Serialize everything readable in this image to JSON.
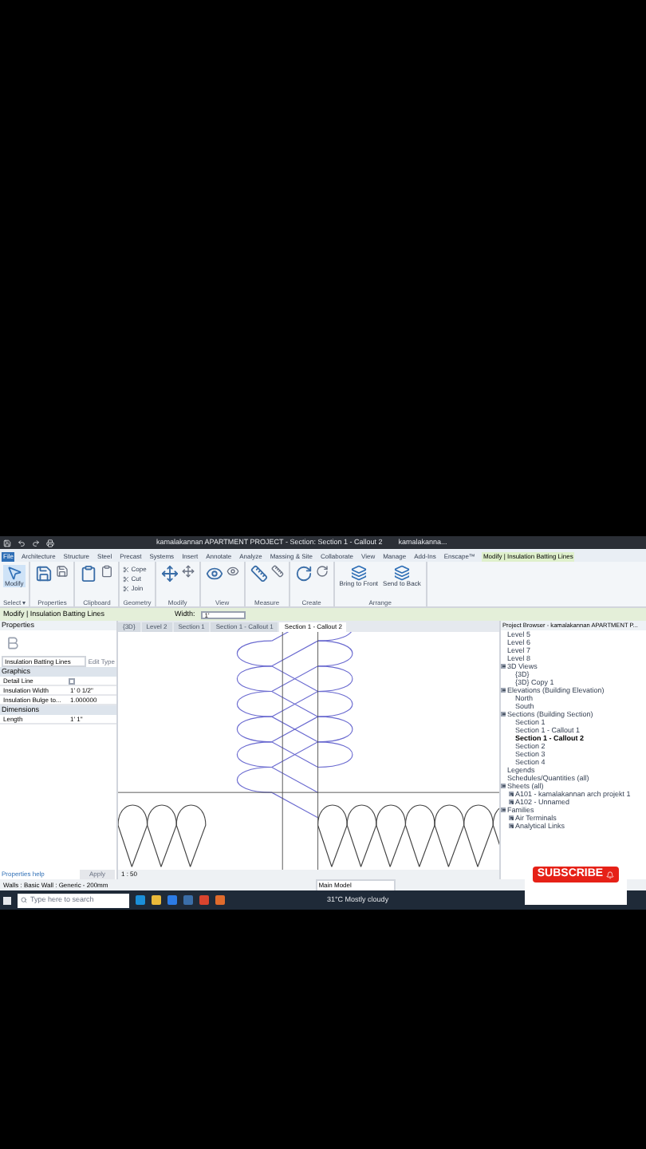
{
  "window": {
    "title": "kamalakannan APARTMENT PROJECT - Section: Section 1 - Callout 2",
    "user": "kamalakanna..."
  },
  "ribbon_tabs": [
    {
      "label": "File",
      "selected": false
    },
    {
      "label": "Architecture",
      "selected": false
    },
    {
      "label": "Structure",
      "selected": false
    },
    {
      "label": "Steel",
      "selected": false
    },
    {
      "label": "Precast",
      "selected": false
    },
    {
      "label": "Systems",
      "selected": false
    },
    {
      "label": "Insert",
      "selected": false
    },
    {
      "label": "Annotate",
      "selected": false
    },
    {
      "label": "Analyze",
      "selected": false
    },
    {
      "label": "Massing & Site",
      "selected": false
    },
    {
      "label": "Collaborate",
      "selected": false
    },
    {
      "label": "View",
      "selected": false
    },
    {
      "label": "Manage",
      "selected": false
    },
    {
      "label": "Add-Ins",
      "selected": false
    },
    {
      "label": "Enscape™",
      "selected": false
    },
    {
      "label": "Modify | Insulation Batting Lines",
      "selected": true
    }
  ],
  "ribbon_panels": [
    {
      "label": "Select ▾",
      "tools": [
        {
          "label": "Modify",
          "kind": "pointer"
        }
      ]
    },
    {
      "label": "Properties",
      "tools": [
        {
          "kind": "props"
        }
      ]
    },
    {
      "label": "Clipboard",
      "tools": [
        {
          "kind": "paste"
        }
      ]
    },
    {
      "label": "Geometry",
      "tools": [
        {
          "label": "Cope",
          "kind": "small"
        },
        {
          "label": "Cut",
          "kind": "small"
        },
        {
          "label": "Join",
          "kind": "small"
        }
      ]
    },
    {
      "label": "Modify",
      "tools": [
        {
          "kind": "modify"
        }
      ]
    },
    {
      "label": "View",
      "tools": [
        {
          "kind": "view"
        }
      ]
    },
    {
      "label": "Measure",
      "tools": [
        {
          "kind": "measure"
        }
      ]
    },
    {
      "label": "Create",
      "tools": [
        {
          "kind": "create"
        }
      ]
    },
    {
      "label": "Arrange",
      "tools": [
        {
          "label": "Bring to Front",
          "kind": "arrange"
        },
        {
          "label": "Send to Back",
          "kind": "arrange"
        }
      ]
    }
  ],
  "options_bar": {
    "context": "Modify | Insulation Batting Lines",
    "width_label": "Width:",
    "width_value": "1'"
  },
  "properties": {
    "title": "Properties",
    "type": "Insulation Batting Lines",
    "edit_type": "Edit Type",
    "sections": [
      {
        "label": "Graphics",
        "rows": [
          {
            "name": "Detail Line",
            "kind": "check",
            "checked": false
          },
          {
            "name": "Insulation Width",
            "kind": "text",
            "value": "1' 0 1/2\""
          },
          {
            "name": "Insulation Bulge to...",
            "kind": "text",
            "value": "1.000000"
          }
        ]
      },
      {
        "label": "Dimensions",
        "rows": [
          {
            "name": "Length",
            "kind": "text",
            "value": "1' 1\""
          }
        ]
      }
    ],
    "help": "Properties help",
    "apply": "Apply"
  },
  "view_tabs": [
    {
      "label": "{3D}",
      "selected": false
    },
    {
      "label": "Level 2",
      "selected": false
    },
    {
      "label": "Section 1",
      "selected": false
    },
    {
      "label": "Section 1 - Callout 1",
      "selected": false
    },
    {
      "label": "Section 1 - Callout 2",
      "selected": true
    }
  ],
  "view_control": {
    "scale": "1 : 50"
  },
  "browser": {
    "title": "Project Browser - kamalakannan APARTMENT P...",
    "items": [
      {
        "children": [
          {
            "children": [
              {
                "label": "Level 5"
              },
              {
                "label": "Level 6"
              },
              {
                "label": "Level 7"
              },
              {
                "label": "Level 8"
              }
            ]
          },
          {
            "label": "3D Views",
            "expanded": true,
            "children": [
              {
                "label": "{3D}"
              },
              {
                "label": "{3D} Copy 1"
              }
            ]
          },
          {
            "label": "Elevations (Building Elevation)",
            "expanded": true,
            "children": [
              {
                "label": "North"
              },
              {
                "label": "South"
              }
            ]
          },
          {
            "label": "Sections (Building Section)",
            "expanded": true,
            "children": [
              {
                "label": "Section 1",
                "selected": false
              },
              {
                "label": "Section 1 - Callout 1",
                "selected": false
              },
              {
                "label": "Section 1 - Callout 2",
                "selected": true
              },
              {
                "label": "Section 2",
                "selected": false
              },
              {
                "label": "Section 3",
                "selected": false
              },
              {
                "label": "Section 4",
                "selected": false
              }
            ]
          }
        ]
      },
      {
        "label": "Legends"
      },
      {
        "label": "Schedules/Quantities (all)"
      },
      {
        "label": "Sheets (all)",
        "expanded": true,
        "children": [
          {
            "label": "A101 - kamalakannan arch projekt 1",
            "expanded": false
          },
          {
            "label": "A102 - Unnamed",
            "expanded": false
          }
        ]
      },
      {
        "label": "Families",
        "expanded": true,
        "children": [
          {
            "label": "Air Terminals",
            "expanded": false
          },
          {
            "label": "Analytical Links",
            "expanded": false
          }
        ]
      }
    ]
  },
  "status_bar": {
    "selection": "Walls : Basic Wall : Generic - 200mm",
    "model": "Main Model"
  },
  "taskbar": {
    "search_placeholder": "Type here to search",
    "weather": "31°C  Mostly cloudy"
  },
  "subscribe": {
    "label": "SUBSCRIBE"
  }
}
